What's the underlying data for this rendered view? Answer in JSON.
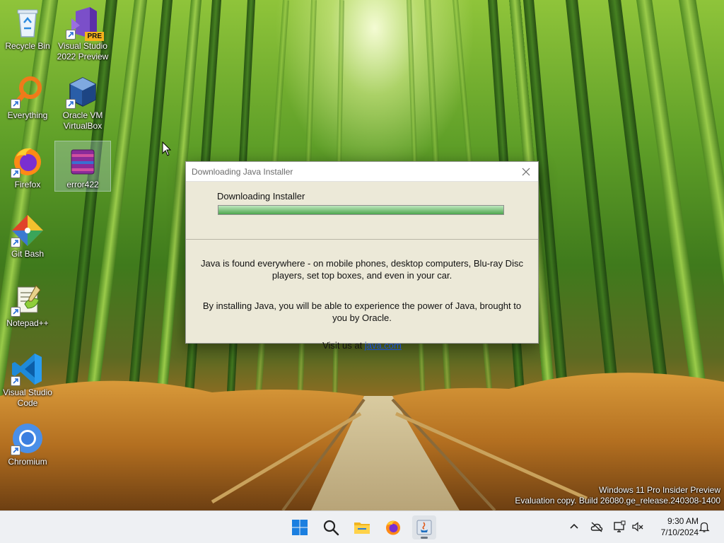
{
  "desktop": {
    "icons": [
      {
        "label": "Recycle Bin"
      },
      {
        "label": "Visual Studio 2022 Preview",
        "badge": "PRE"
      },
      {
        "label": "Everything"
      },
      {
        "label": "Oracle VM VirtualBox"
      },
      {
        "label": "Firefox"
      },
      {
        "label": "error422"
      },
      {
        "label": "Git Bash"
      },
      {
        "label": "Notepad++"
      },
      {
        "label": "Visual Studio Code"
      },
      {
        "label": "Chromium"
      }
    ]
  },
  "dialog": {
    "title": "Downloading Java Installer",
    "status": "Downloading Installer",
    "progress": 1.0,
    "paragraph1": "Java is found everywhere - on mobile phones, desktop computers, Blu-ray Disc players, set top boxes, and even in your car.",
    "paragraph2": "By installing Java, you will be able to experience the power of Java, brought to you by Oracle.",
    "visit_prefix": "Visit us at ",
    "visit_link": "java.com"
  },
  "watermark": {
    "line1": "Windows 11 Pro Insider Preview",
    "line2": "Evaluation copy. Build 26080.ge_release.240308-1400"
  },
  "taskbar": {
    "apps": [
      {
        "name": "start-button",
        "icon": "windows-logo-icon"
      },
      {
        "name": "search-button",
        "icon": "search-icon"
      },
      {
        "name": "file-explorer",
        "icon": "folder-icon"
      },
      {
        "name": "firefox",
        "icon": "firefox-icon"
      },
      {
        "name": "java-installer",
        "icon": "java-icon",
        "active": true
      }
    ],
    "clock": {
      "time": "9:30 AM",
      "date": "7/10/2024"
    }
  },
  "colors": {
    "dialog_bg": "#ece9d8",
    "link": "#1a4fd8",
    "taskbar_bg": "#eef0f3",
    "progress_fill": "#4ea64e"
  }
}
